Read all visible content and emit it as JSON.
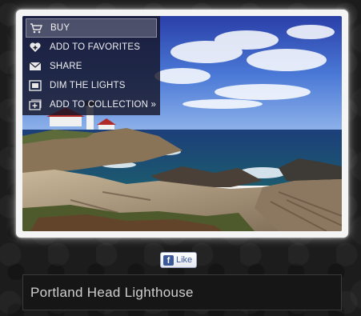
{
  "photo": {
    "alt_name": "lighthouse-photo"
  },
  "menu": {
    "items": [
      {
        "label": "BUY",
        "icon": "cart-icon",
        "active": true
      },
      {
        "label": "ADD TO FAVORITES",
        "icon": "heart-plus-icon",
        "active": false
      },
      {
        "label": "SHARE",
        "icon": "envelope-icon",
        "active": false
      },
      {
        "label": "DIM THE LIGHTS",
        "icon": "dim-lights-icon",
        "active": false
      },
      {
        "label": "ADD TO COLLECTION »",
        "icon": "collection-add-icon",
        "active": false
      }
    ]
  },
  "like_button": {
    "brand": "f",
    "label": "Like",
    "color": "#3b5998"
  },
  "caption": {
    "title": "Portland Head Lighthouse"
  }
}
